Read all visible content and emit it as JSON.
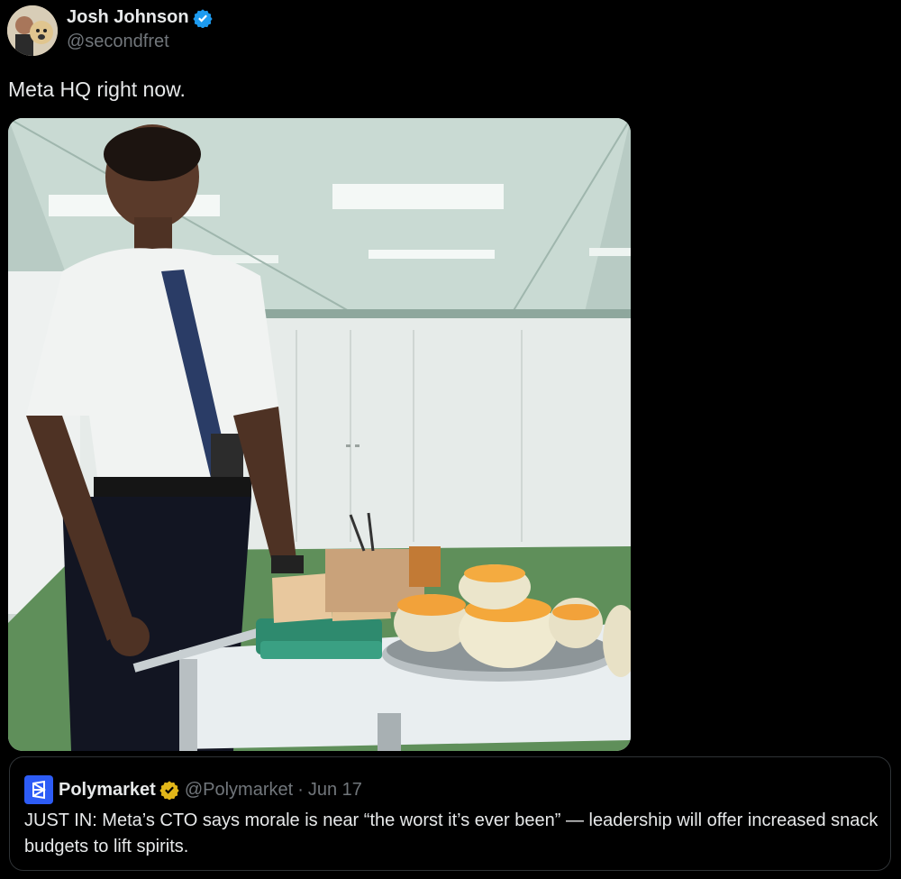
{
  "author": {
    "display_name": "Josh Johnson",
    "handle": "@secondfret",
    "verified": true,
    "verified_color": "#1d9bf0"
  },
  "tweet": {
    "text": "Meta HQ right now."
  },
  "media": {
    "kind": "photo",
    "icon": "photo"
  },
  "quoted_tweet": {
    "display_name": "Polymarket",
    "handle": "@Polymarket",
    "separator": "·",
    "date": "Jun 17",
    "verified_color": "#e2b719",
    "logo_color": "#2d5cf6",
    "text": "JUST IN: Meta’s CTO says morale is near “the worst it’s ever been” — leadership will offer increased snack budgets to lift spirits."
  }
}
